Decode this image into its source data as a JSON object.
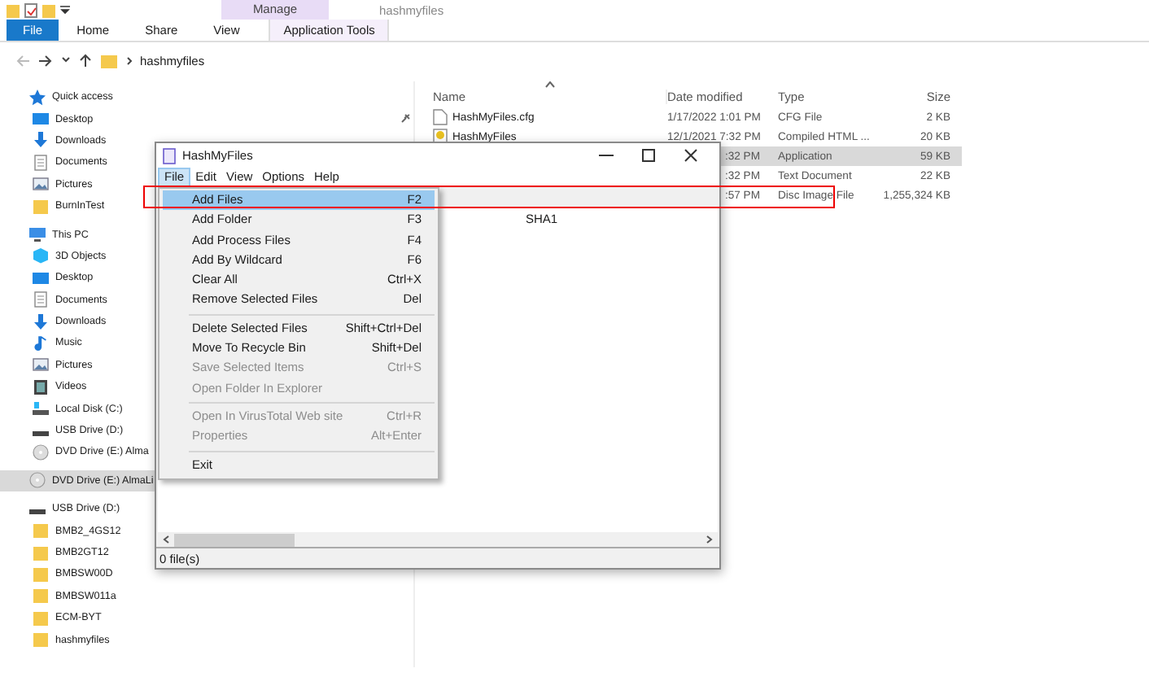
{
  "title_bar": {
    "context_tab": "Manage",
    "title": "hashmyfiles"
  },
  "ribbon": {
    "tabs": [
      {
        "label": "File",
        "kind": "file"
      },
      {
        "label": "Home",
        "kind": "normal"
      },
      {
        "label": "Share",
        "kind": "normal"
      },
      {
        "label": "View",
        "kind": "normal"
      },
      {
        "label": "Application Tools",
        "kind": "context"
      }
    ]
  },
  "address_bar": {
    "path": "hashmyfiles"
  },
  "nav_pane": {
    "items": [
      {
        "label": "Quick access",
        "kind": "star",
        "selected": false,
        "children": [
          {
            "label": "Desktop",
            "kind": "desktop",
            "pinned": true,
            "selected": false
          },
          {
            "label": "Downloads",
            "kind": "downloads",
            "selected": false
          },
          {
            "label": "Documents",
            "kind": "documents",
            "selected": false
          },
          {
            "label": "Pictures",
            "kind": "pictures",
            "selected": false
          },
          {
            "label": "BurnInTest",
            "kind": "folder",
            "selected": false
          }
        ]
      },
      {
        "label": "This PC",
        "kind": "pc",
        "selected": false,
        "children": [
          {
            "label": "3D Objects",
            "kind": "cube",
            "selected": false
          },
          {
            "label": "Desktop",
            "kind": "desktop",
            "selected": false
          },
          {
            "label": "Documents",
            "kind": "documents",
            "selected": false
          },
          {
            "label": "Downloads",
            "kind": "downloads",
            "selected": false
          },
          {
            "label": "Music",
            "kind": "music",
            "selected": false
          },
          {
            "label": "Pictures",
            "kind": "pictures",
            "selected": false
          },
          {
            "label": "Videos",
            "kind": "videos",
            "selected": false
          },
          {
            "label": "Local Disk (C:)",
            "kind": "disk",
            "selected": false
          },
          {
            "label": "USB Drive (D:)",
            "kind": "usb",
            "selected": false
          },
          {
            "label": "DVD Drive (E:) Alma",
            "kind": "dvd",
            "selected": false
          }
        ]
      },
      {
        "label": "DVD Drive (E:) AlmaLi",
        "kind": "dvd",
        "selected": true
      },
      {
        "label": "USB Drive (D:)",
        "kind": "usb",
        "selected": false,
        "children": [
          {
            "label": "BMB2_4GS12",
            "kind": "folder",
            "selected": false
          },
          {
            "label": "BMB2GT12",
            "kind": "folder",
            "selected": false
          },
          {
            "label": "BMBSW00D",
            "kind": "folder",
            "selected": false
          },
          {
            "label": "BMBSW011a",
            "kind": "folder",
            "selected": false
          },
          {
            "label": "ECM-BYT",
            "kind": "folder",
            "selected": false
          },
          {
            "label": "hashmyfiles",
            "kind": "folder",
            "selected": false
          }
        ]
      }
    ]
  },
  "file_list": {
    "columns": [
      "Name",
      "Date modified",
      "Type",
      "Size"
    ],
    "rows": [
      {
        "name": "HashMyFiles.cfg",
        "kind": "text",
        "date": "1/17/2022 1:01 PM",
        "type": "CFG File",
        "size": "2 KB",
        "selected": false
      },
      {
        "name": "HashMyFiles",
        "kind": "help",
        "date": "12/1/2021 7:32 PM",
        "type": "Compiled HTML ...",
        "size": "20 KB",
        "selected": false
      },
      {
        "date": ":32 PM",
        "type": "Application",
        "size": "59 KB",
        "selected": true
      },
      {
        "date": ":32 PM",
        "type": "Text Document",
        "size": "22 KB",
        "selected": false
      },
      {
        "date": ":57 PM",
        "type": "Disc Image File",
        "size": "1,255,324 KB",
        "selected": false
      }
    ]
  },
  "app_window": {
    "title": "HashMyFiles",
    "menu": [
      {
        "label": "File",
        "selected": true
      },
      {
        "label": "Edit",
        "selected": false
      },
      {
        "label": "View",
        "selected": false
      },
      {
        "label": "Options",
        "selected": false
      },
      {
        "label": "Help",
        "selected": false
      }
    ],
    "column_header": "SHA1",
    "status": "0 file(s)"
  },
  "file_menu": {
    "groups": [
      [
        {
          "label": "Add Files",
          "shortcut": "F2",
          "selected": true,
          "disabled": false
        },
        {
          "label": "Add Folder",
          "shortcut": "F3",
          "selected": false,
          "disabled": false
        },
        {
          "label": "Add Process Files",
          "shortcut": "F4",
          "selected": false,
          "disabled": false
        },
        {
          "label": "Add By Wildcard",
          "shortcut": "F6",
          "selected": false,
          "disabled": false
        },
        {
          "label": "Clear All",
          "shortcut": "Ctrl+X",
          "selected": false,
          "disabled": false
        },
        {
          "label": "Remove Selected Files",
          "shortcut": "Del",
          "selected": false,
          "disabled": false
        }
      ],
      [
        {
          "label": "Delete Selected Files",
          "shortcut": "Shift+Ctrl+Del",
          "selected": false,
          "disabled": false
        },
        {
          "label": "Move To Recycle Bin",
          "shortcut": "Shift+Del",
          "selected": false,
          "disabled": false
        },
        {
          "label": "Save Selected Items",
          "shortcut": "Ctrl+S",
          "selected": false,
          "disabled": true
        },
        {
          "label": "Open Folder In Explorer",
          "selected": false,
          "disabled": true
        }
      ],
      [
        {
          "label": "Open In VirusTotal Web site",
          "shortcut": "Ctrl+R",
          "selected": false,
          "disabled": true
        },
        {
          "label": "Properties",
          "shortcut": "Alt+Enter",
          "selected": false,
          "disabled": true
        }
      ],
      [
        {
          "label": "Exit",
          "selected": false,
          "disabled": false
        }
      ]
    ]
  }
}
